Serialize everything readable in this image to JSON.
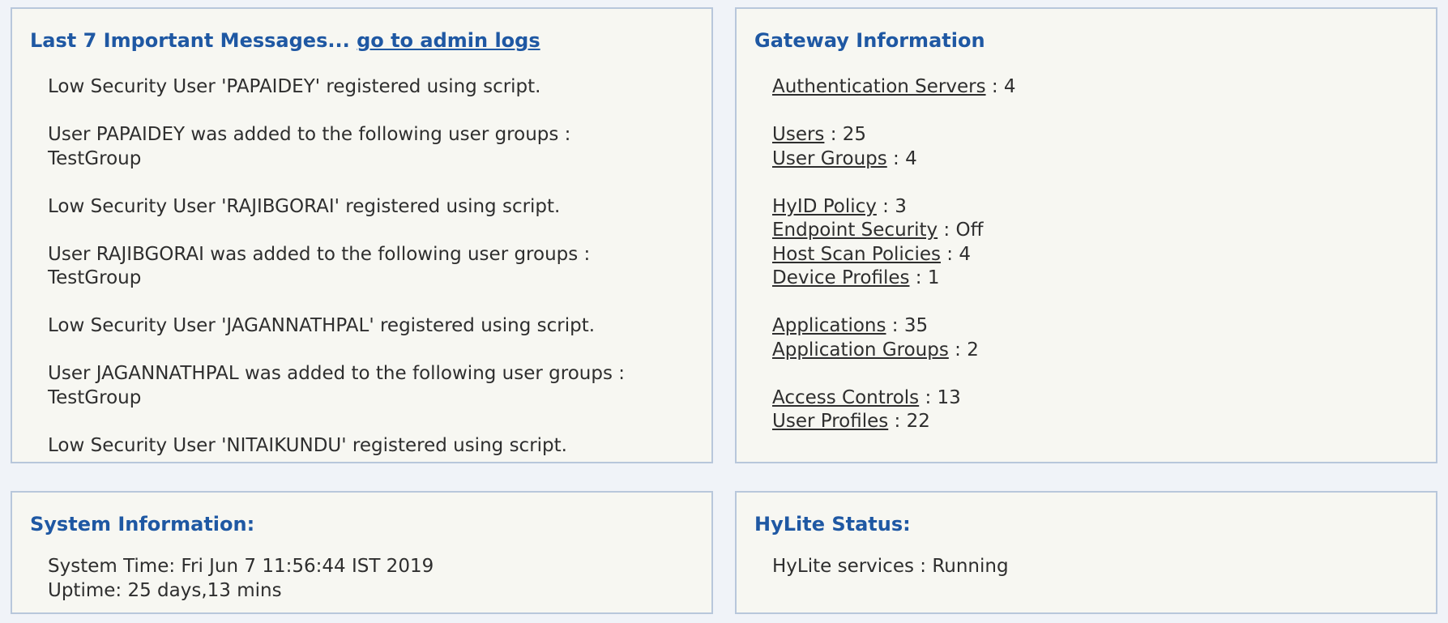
{
  "messages_panel": {
    "title": "Last 7 Important Messages...",
    "link": "go to admin logs",
    "messages": [
      {
        "line1": "Low Security User 'PAPAIDEY' registered using script.",
        "line2": ""
      },
      {
        "line1": "User PAPAIDEY was added to the following user groups :",
        "line2": "TestGroup"
      },
      {
        "line1": "Low Security User 'RAJIBGORAI' registered using script.",
        "line2": ""
      },
      {
        "line1": "User RAJIBGORAI was added to the following user groups :",
        "line2": "TestGroup"
      },
      {
        "line1": "Low Security User 'JAGANNATHPAL' registered using script.",
        "line2": ""
      },
      {
        "line1": "User JAGANNATHPAL was added to the following user groups :",
        "line2": "TestGroup"
      },
      {
        "line1": "Low Security User 'NITAIKUNDU' registered using script.",
        "line2": ""
      }
    ]
  },
  "gateway_panel": {
    "title": "Gateway Information",
    "groups": [
      [
        {
          "label": "Authentication Servers",
          "value": " : 4"
        }
      ],
      [
        {
          "label": "Users",
          "value": " : 25"
        },
        {
          "label": "User Groups",
          "value": " : 4"
        }
      ],
      [
        {
          "label": "HyID Policy",
          "value": " : 3"
        },
        {
          "label": "Endpoint Security",
          "value": " : Off"
        },
        {
          "label": "Host Scan Policies",
          "value": " : 4"
        },
        {
          "label": "Device Profiles",
          "value": " : 1"
        }
      ],
      [
        {
          "label": "Applications",
          "value": " : 35"
        },
        {
          "label": "Application Groups",
          "value": " : 2"
        }
      ],
      [
        {
          "label": "Access Controls",
          "value": " : 13"
        },
        {
          "label": "User Profiles",
          "value": " : 22"
        }
      ]
    ]
  },
  "system_panel": {
    "title": "System Information:",
    "time": "System Time: Fri Jun 7 11:56:44 IST 2019",
    "uptime": "Uptime: 25 days,13 mins"
  },
  "hylite_panel": {
    "title": "HyLite Status:",
    "status": "HyLite services : Running"
  }
}
